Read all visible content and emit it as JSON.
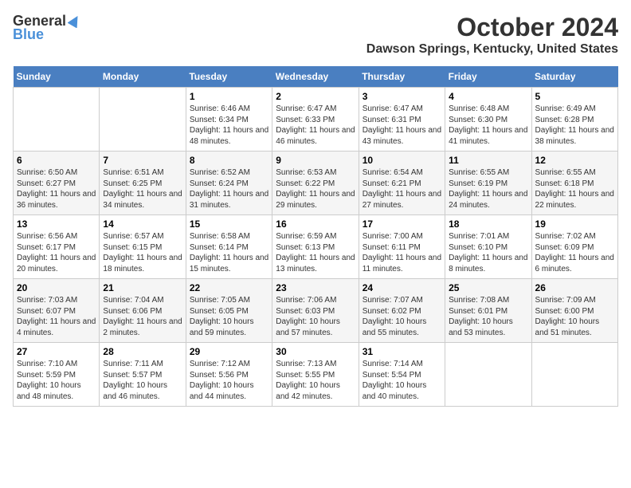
{
  "logo": {
    "general": "General",
    "blue": "Blue"
  },
  "title": "October 2024",
  "location": "Dawson Springs, Kentucky, United States",
  "days_of_week": [
    "Sunday",
    "Monday",
    "Tuesday",
    "Wednesday",
    "Thursday",
    "Friday",
    "Saturday"
  ],
  "weeks": [
    [
      {
        "day": "",
        "info": ""
      },
      {
        "day": "",
        "info": ""
      },
      {
        "day": "1",
        "info": "Sunrise: 6:46 AM\nSunset: 6:34 PM\nDaylight: 11 hours and 48 minutes."
      },
      {
        "day": "2",
        "info": "Sunrise: 6:47 AM\nSunset: 6:33 PM\nDaylight: 11 hours and 46 minutes."
      },
      {
        "day": "3",
        "info": "Sunrise: 6:47 AM\nSunset: 6:31 PM\nDaylight: 11 hours and 43 minutes."
      },
      {
        "day": "4",
        "info": "Sunrise: 6:48 AM\nSunset: 6:30 PM\nDaylight: 11 hours and 41 minutes."
      },
      {
        "day": "5",
        "info": "Sunrise: 6:49 AM\nSunset: 6:28 PM\nDaylight: 11 hours and 38 minutes."
      }
    ],
    [
      {
        "day": "6",
        "info": "Sunrise: 6:50 AM\nSunset: 6:27 PM\nDaylight: 11 hours and 36 minutes."
      },
      {
        "day": "7",
        "info": "Sunrise: 6:51 AM\nSunset: 6:25 PM\nDaylight: 11 hours and 34 minutes."
      },
      {
        "day": "8",
        "info": "Sunrise: 6:52 AM\nSunset: 6:24 PM\nDaylight: 11 hours and 31 minutes."
      },
      {
        "day": "9",
        "info": "Sunrise: 6:53 AM\nSunset: 6:22 PM\nDaylight: 11 hours and 29 minutes."
      },
      {
        "day": "10",
        "info": "Sunrise: 6:54 AM\nSunset: 6:21 PM\nDaylight: 11 hours and 27 minutes."
      },
      {
        "day": "11",
        "info": "Sunrise: 6:55 AM\nSunset: 6:19 PM\nDaylight: 11 hours and 24 minutes."
      },
      {
        "day": "12",
        "info": "Sunrise: 6:55 AM\nSunset: 6:18 PM\nDaylight: 11 hours and 22 minutes."
      }
    ],
    [
      {
        "day": "13",
        "info": "Sunrise: 6:56 AM\nSunset: 6:17 PM\nDaylight: 11 hours and 20 minutes."
      },
      {
        "day": "14",
        "info": "Sunrise: 6:57 AM\nSunset: 6:15 PM\nDaylight: 11 hours and 18 minutes."
      },
      {
        "day": "15",
        "info": "Sunrise: 6:58 AM\nSunset: 6:14 PM\nDaylight: 11 hours and 15 minutes."
      },
      {
        "day": "16",
        "info": "Sunrise: 6:59 AM\nSunset: 6:13 PM\nDaylight: 11 hours and 13 minutes."
      },
      {
        "day": "17",
        "info": "Sunrise: 7:00 AM\nSunset: 6:11 PM\nDaylight: 11 hours and 11 minutes."
      },
      {
        "day": "18",
        "info": "Sunrise: 7:01 AM\nSunset: 6:10 PM\nDaylight: 11 hours and 8 minutes."
      },
      {
        "day": "19",
        "info": "Sunrise: 7:02 AM\nSunset: 6:09 PM\nDaylight: 11 hours and 6 minutes."
      }
    ],
    [
      {
        "day": "20",
        "info": "Sunrise: 7:03 AM\nSunset: 6:07 PM\nDaylight: 11 hours and 4 minutes."
      },
      {
        "day": "21",
        "info": "Sunrise: 7:04 AM\nSunset: 6:06 PM\nDaylight: 11 hours and 2 minutes."
      },
      {
        "day": "22",
        "info": "Sunrise: 7:05 AM\nSunset: 6:05 PM\nDaylight: 10 hours and 59 minutes."
      },
      {
        "day": "23",
        "info": "Sunrise: 7:06 AM\nSunset: 6:03 PM\nDaylight: 10 hours and 57 minutes."
      },
      {
        "day": "24",
        "info": "Sunrise: 7:07 AM\nSunset: 6:02 PM\nDaylight: 10 hours and 55 minutes."
      },
      {
        "day": "25",
        "info": "Sunrise: 7:08 AM\nSunset: 6:01 PM\nDaylight: 10 hours and 53 minutes."
      },
      {
        "day": "26",
        "info": "Sunrise: 7:09 AM\nSunset: 6:00 PM\nDaylight: 10 hours and 51 minutes."
      }
    ],
    [
      {
        "day": "27",
        "info": "Sunrise: 7:10 AM\nSunset: 5:59 PM\nDaylight: 10 hours and 48 minutes."
      },
      {
        "day": "28",
        "info": "Sunrise: 7:11 AM\nSunset: 5:57 PM\nDaylight: 10 hours and 46 minutes."
      },
      {
        "day": "29",
        "info": "Sunrise: 7:12 AM\nSunset: 5:56 PM\nDaylight: 10 hours and 44 minutes."
      },
      {
        "day": "30",
        "info": "Sunrise: 7:13 AM\nSunset: 5:55 PM\nDaylight: 10 hours and 42 minutes."
      },
      {
        "day": "31",
        "info": "Sunrise: 7:14 AM\nSunset: 5:54 PM\nDaylight: 10 hours and 40 minutes."
      },
      {
        "day": "",
        "info": ""
      },
      {
        "day": "",
        "info": ""
      }
    ]
  ]
}
